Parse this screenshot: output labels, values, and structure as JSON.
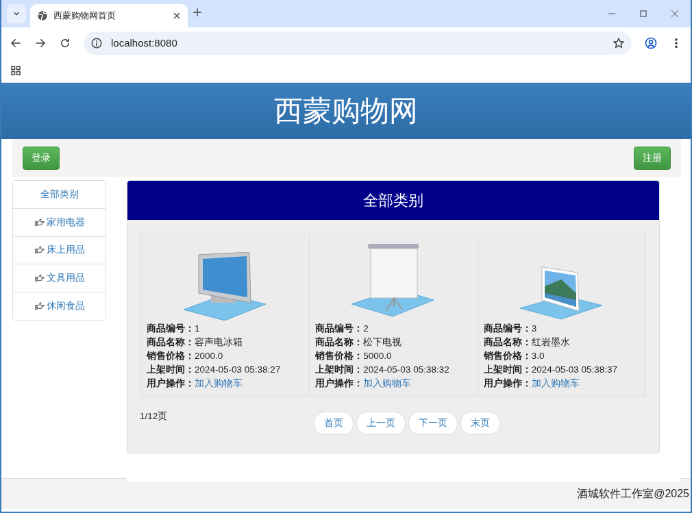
{
  "browser": {
    "tab_title": "西蒙购物网首页",
    "address": "localhost:8080"
  },
  "header": {
    "title": "西蒙购物网"
  },
  "nav": {
    "login": "登录",
    "register": "注册"
  },
  "sidebar": {
    "items": [
      {
        "label": "全部类别",
        "kind": "plain"
      },
      {
        "label": "家用电器",
        "kind": "hand"
      },
      {
        "label": "床上用品",
        "kind": "hand"
      },
      {
        "label": "文具用品",
        "kind": "hand"
      },
      {
        "label": "休闲食品",
        "kind": "hand"
      }
    ]
  },
  "panel": {
    "title": "全部类别",
    "products": [
      {
        "kind": "monitor",
        "fields": [
          {
            "label": "商品编号：",
            "value": "1"
          },
          {
            "label": "商品名称：",
            "value": "容声电冰箱"
          },
          {
            "label": "销售价格：",
            "value": "2000.0"
          },
          {
            "label": "上架时间：",
            "value": "2024-05-03 05:38:27"
          }
        ],
        "action_label": "用户操作：",
        "action": "加入购物车"
      },
      {
        "kind": "screen",
        "fields": [
          {
            "label": "商品编号：",
            "value": "2"
          },
          {
            "label": "商品名称：",
            "value": "松下电视"
          },
          {
            "label": "销售价格：",
            "value": "5000.0"
          },
          {
            "label": "上架时间：",
            "value": "2024-05-03 05:38:32"
          }
        ],
        "action_label": "用户操作：",
        "action": "加入购物车"
      },
      {
        "kind": "frame",
        "fields": [
          {
            "label": "商品编号：",
            "value": "3"
          },
          {
            "label": "商品名称：",
            "value": "红岩墨水"
          },
          {
            "label": "销售价格：",
            "value": "3.0"
          },
          {
            "label": "上架时间：",
            "value": "2024-05-03 05:38:37"
          }
        ],
        "action_label": "用户操作：",
        "action": "加入购物车"
      }
    ],
    "page_info": "1/12页",
    "pager": [
      "首页",
      "上一页",
      "下一页",
      "末页"
    ]
  },
  "footer": "酒城软件工作室@2025"
}
